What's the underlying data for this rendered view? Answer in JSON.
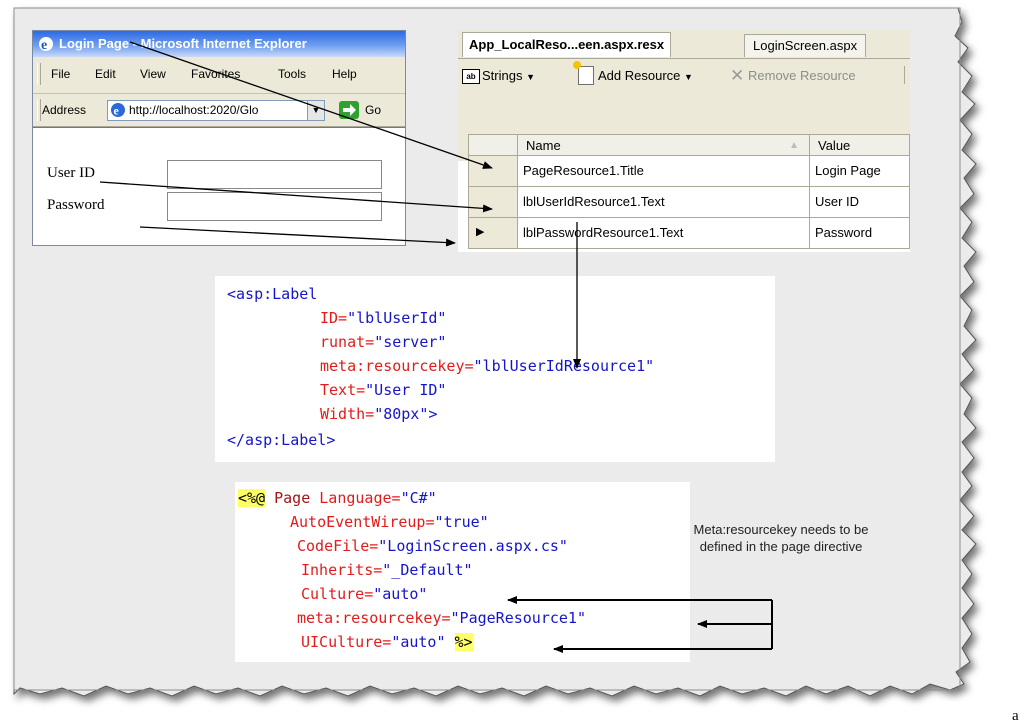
{
  "ie": {
    "title": "Login Page - Microsoft Internet Explorer",
    "menu": [
      "File",
      "Edit",
      "View",
      "Favorites",
      "Tools",
      "Help"
    ],
    "address_label": "Address",
    "address_value": "http://localhost:2020/Glo",
    "go_label": "Go",
    "form": {
      "userid_label": "User ID",
      "password_label": "Password"
    }
  },
  "vs": {
    "tabs": [
      "App_LocalReso...een.aspx.resx",
      "LoginScreen.aspx"
    ],
    "toolbar": {
      "strings_icon": "ab",
      "strings": "Strings",
      "add": "Add Resource",
      "remove": "Remove Resource"
    },
    "grid": {
      "headers": [
        "Name",
        "Value"
      ],
      "rows": [
        {
          "name": "PageResource1.Title",
          "value": "Login Page"
        },
        {
          "name": "lblUserIdResource1.Text",
          "value": "User ID"
        },
        {
          "name": "lblPasswordResource1.Text",
          "value": "Password"
        }
      ]
    }
  },
  "code_label": {
    "line1": "<asp:Label",
    "id_attr": "ID=",
    "id_val": "\"lblUserId\"",
    "runat_attr": "runat=",
    "runat_val": "\"server\"",
    "meta_attr": "meta:resourcekey=",
    "meta_val": "\"lblUserIdResource1\"",
    "text_attr": "Text=",
    "text_val": "\"User ID\"",
    "width_attr": "Width=",
    "width_val": "\"80px\">",
    "close": "</asp:Label>"
  },
  "code_page": {
    "open": "<%@",
    "page": " Page ",
    "lang_attr": "Language=",
    "lang_val": "\"C#\"",
    "autoevent": "AutoEventWireup=",
    "autoevent_val": "\"true\"",
    "codefile": "CodeFile=",
    "codefile_val": "\"LoginScreen.aspx.cs\"",
    "inherits": "Inherits=",
    "inherits_val": "\"_Default\"",
    "culture": "Culture=",
    "culture_val": "\"auto\"",
    "meta": "meta:resourcekey=",
    "meta_val": "\"PageResource1\"",
    "uiculture": "UICulture=",
    "uiculture_val": "\"auto\" ",
    "close": "%>"
  },
  "note": "Meta:resourcekey needs to be defined in the page directive",
  "corner_letter": "a"
}
